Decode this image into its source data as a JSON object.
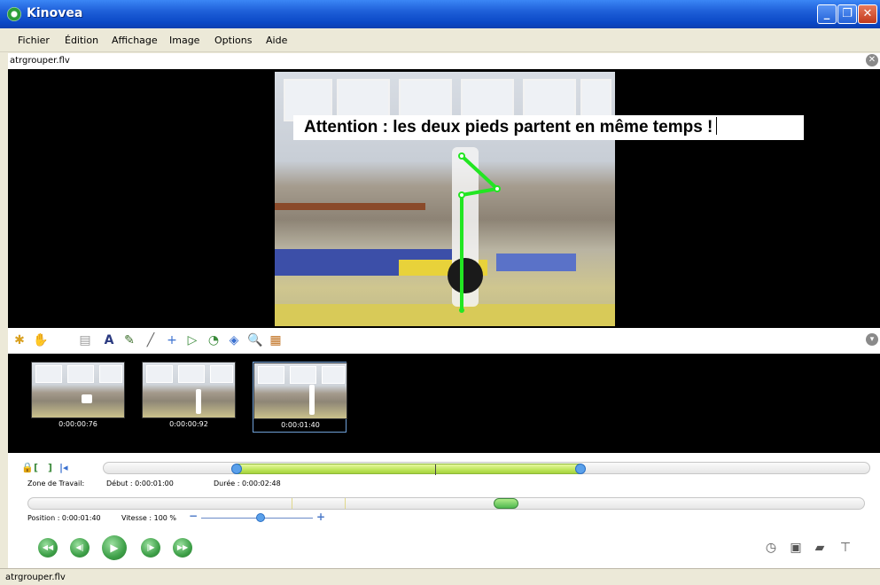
{
  "window": {
    "title": "Kinovea"
  },
  "menu": [
    "Fichier",
    "Édition",
    "Affichage",
    "Image",
    "Options",
    "Aide"
  ],
  "file": {
    "name": "atrgrouper.flv"
  },
  "video": {
    "annotation": "Attention : les deux pieds partent en même temps !"
  },
  "keyframes": [
    {
      "time": "0:00:00:76"
    },
    {
      "time": "0:00:00:92"
    },
    {
      "time": "0:00:01:40"
    }
  ],
  "workzone": {
    "label": "Zone de Travail:",
    "start": "Début : 0:00:01:00",
    "duration": "Durée : 0:00:02:48"
  },
  "playback": {
    "position": "Position : 0:00:01:40",
    "speed": "Vitesse : 100 %"
  },
  "markers": {
    "in": "[",
    "out": "]",
    "to_start": "|◂"
  },
  "icons": {
    "lock": "lock-icon",
    "zoom": "🔍"
  },
  "status": {
    "text": "atrgrouper.flv"
  },
  "colors": {
    "accent": "#0a48c6",
    "skeleton": "#22e622",
    "workzone": "#bde55a"
  }
}
